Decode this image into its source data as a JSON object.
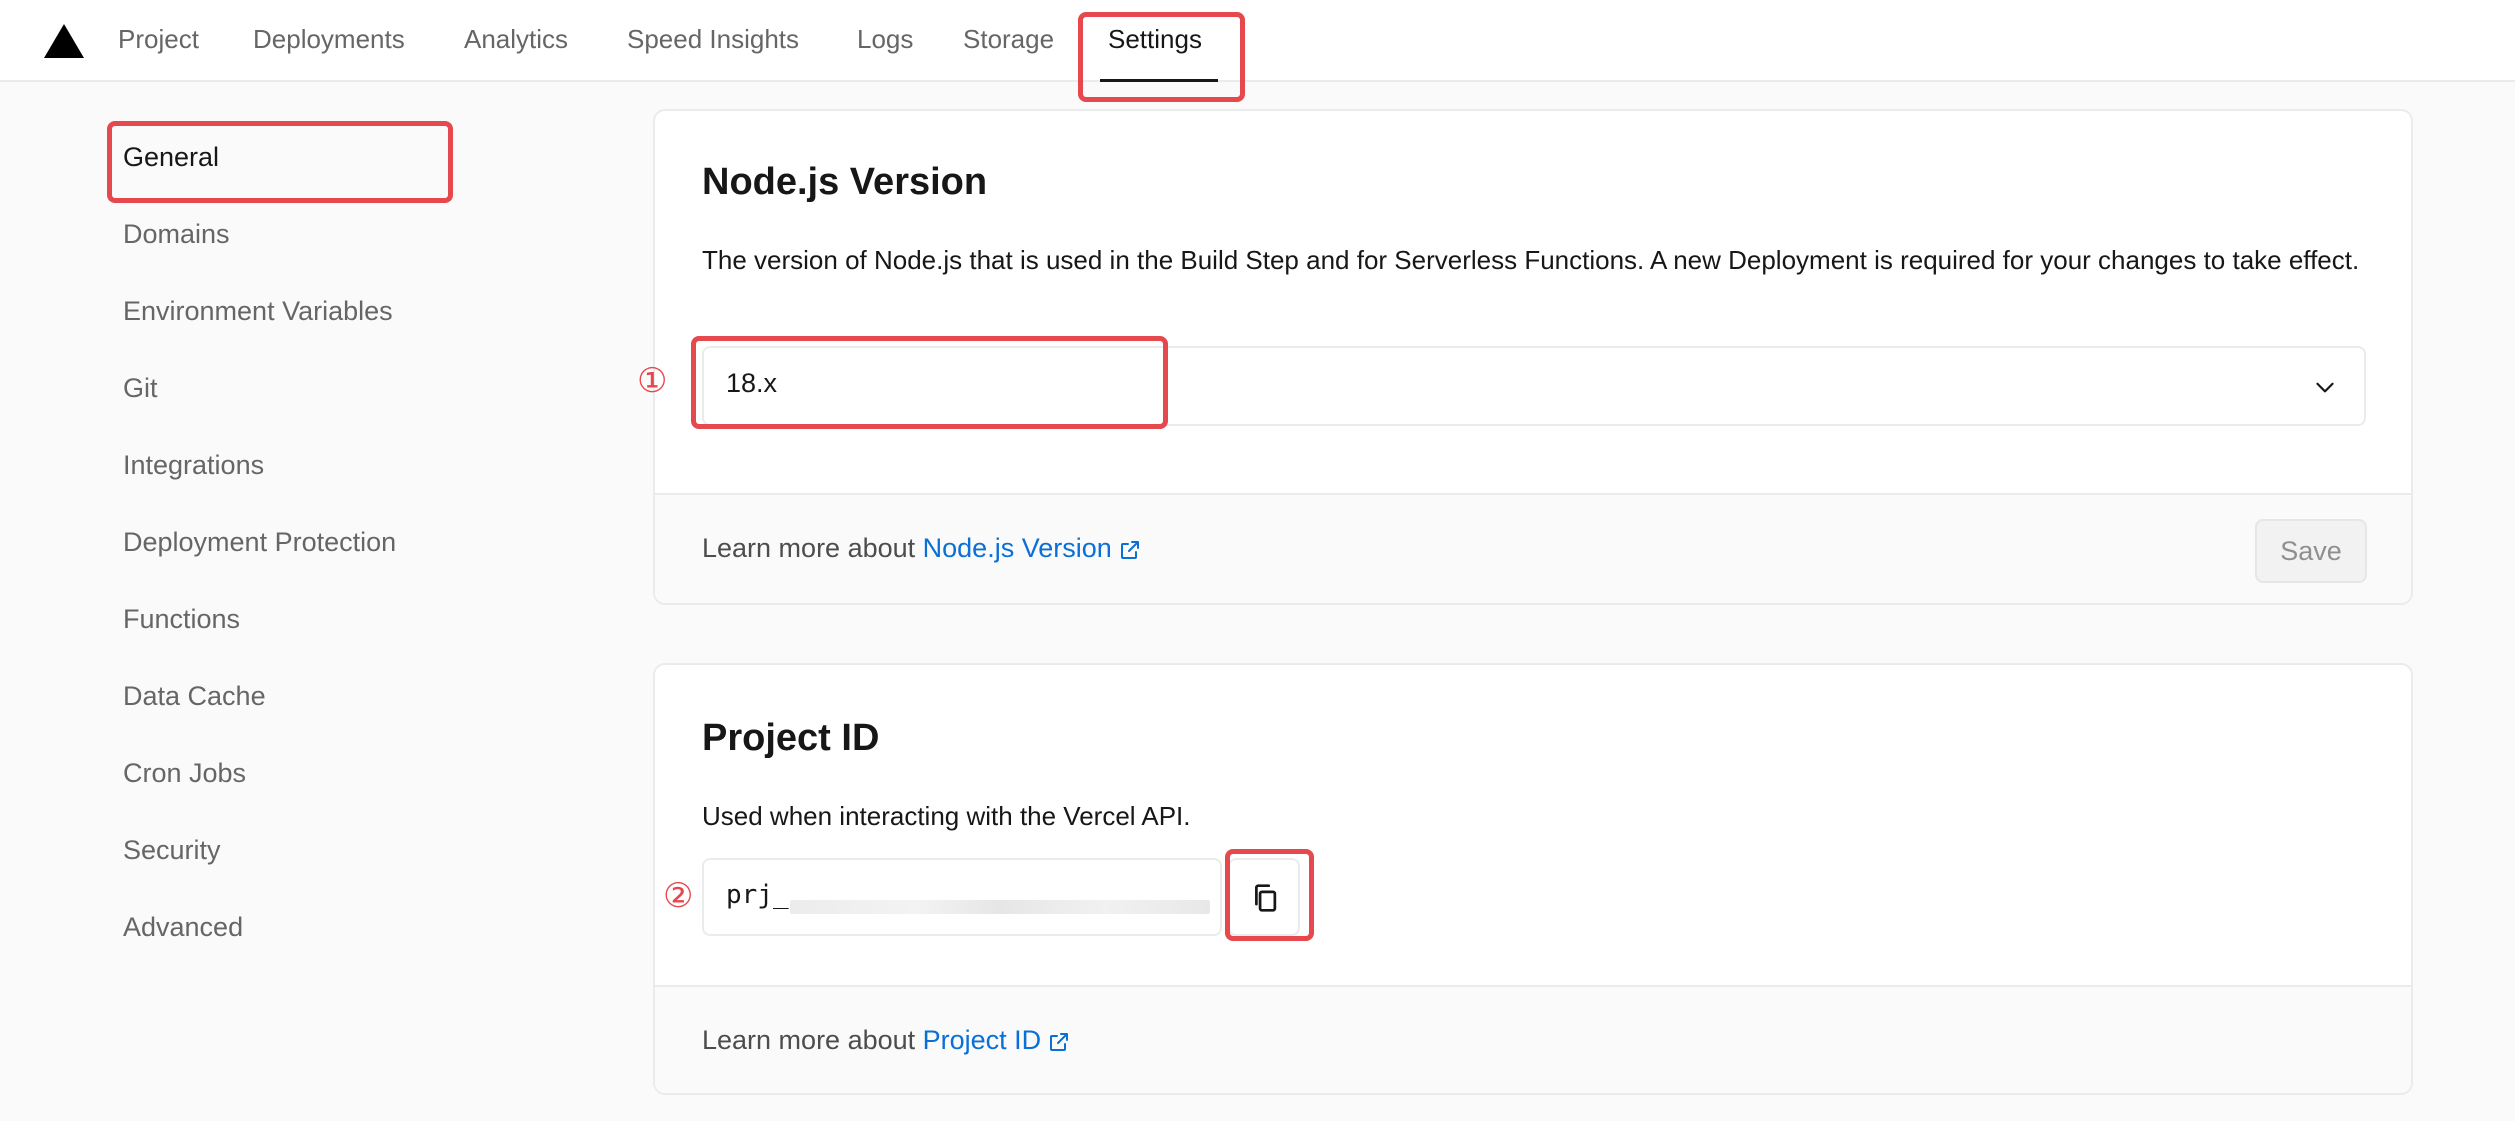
{
  "nav": {
    "tabs": [
      {
        "label": "Project"
      },
      {
        "label": "Deployments"
      },
      {
        "label": "Analytics"
      },
      {
        "label": "Speed Insights"
      },
      {
        "label": "Logs"
      },
      {
        "label": "Storage"
      },
      {
        "label": "Settings",
        "active": true
      }
    ]
  },
  "sidebar": {
    "items": [
      {
        "label": "General",
        "active": true
      },
      {
        "label": "Domains"
      },
      {
        "label": "Environment Variables"
      },
      {
        "label": "Git"
      },
      {
        "label": "Integrations"
      },
      {
        "label": "Deployment Protection"
      },
      {
        "label": "Functions"
      },
      {
        "label": "Data Cache"
      },
      {
        "label": "Cron Jobs"
      },
      {
        "label": "Security"
      },
      {
        "label": "Advanced"
      }
    ]
  },
  "node_card": {
    "title": "Node.js Version",
    "description": "The version of Node.js that is used in the Build Step and for Serverless Functions. A new Deployment is required for your changes to take effect.",
    "select_value": "18.x",
    "footer_prefix": "Learn more about ",
    "footer_link": "Node.js Version",
    "save_label": "Save"
  },
  "project_card": {
    "title": "Project ID",
    "description": "Used when interacting with the Vercel API.",
    "id_prefix": "prj_",
    "footer_prefix": "Learn more about ",
    "footer_link": "Project ID"
  },
  "annotations": {
    "marker_1": "①",
    "marker_2": "②",
    "highlight_color": "#e5484d"
  },
  "colors": {
    "link": "#0a6fd6",
    "text": "#171717",
    "muted": "#666666"
  }
}
